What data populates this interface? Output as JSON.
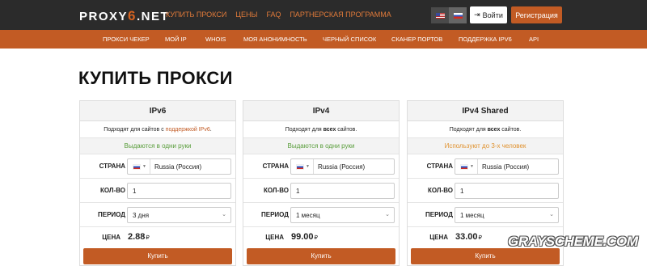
{
  "header": {
    "logo_main": "PROXY",
    "logo_six": "6",
    "logo_tail": ".NET",
    "nav": [
      {
        "label": "КУПИТЬ ПРОКСИ"
      },
      {
        "label": "ЦЕНЫ"
      },
      {
        "label": "FAQ"
      },
      {
        "label": "ПАРТНЕРСКАЯ ПРОГРАММА"
      }
    ],
    "login_label": "Войти",
    "register_label": "Регистрация",
    "colors": {
      "bar": "#2b2b2b",
      "accent": "#c25b24",
      "link": "#e07a3a"
    }
  },
  "subnav": [
    {
      "label": "ПРОКСИ ЧЕКЕР"
    },
    {
      "label": "МОЙ IP"
    },
    {
      "label": "WHOIS"
    },
    {
      "label": "МОЯ АНОНИМНОСТЬ"
    },
    {
      "label": "ЧЕРНЫЙ СПИСОК"
    },
    {
      "label": "СКАНЕР ПОРТОВ"
    },
    {
      "label": "ПОДДЕРЖКА IPV6"
    },
    {
      "label": "API"
    }
  ],
  "page_title": "КУПИТЬ ПРОКСИ",
  "labels": {
    "country": "СТРАНА",
    "quantity": "КОЛ-ВО",
    "period": "ПЕРИОД",
    "price": "ЦЕНА",
    "buy": "Купить",
    "currency": "₽"
  },
  "cards": [
    {
      "title": "IPv6",
      "desc_pre": "Подходят для сайтов с ",
      "desc_hl": "поддержкой IPv6",
      "desc_post": ".",
      "status": "Выдаются в одни руки",
      "status_color": "green",
      "country": "Russia (Россия)",
      "quantity": "1",
      "period": "3 дня",
      "price": "2.88"
    },
    {
      "title": "IPv4",
      "desc_pre": "Подходят для ",
      "desc_hl": "всех",
      "desc_post": " сайтов.",
      "status": "Выдаются в одни руки",
      "status_color": "green",
      "country": "Russia (Россия)",
      "quantity": "1",
      "period": "1 месяц",
      "price": "99.00"
    },
    {
      "title": "IPv4 Shared",
      "desc_pre": "Подходят для ",
      "desc_hl": "всех",
      "desc_post": " сайтов.",
      "status": "Используют до 3-х человек",
      "status_color": "orange",
      "country": "Russia (Россия)",
      "quantity": "1",
      "period": "1 месяц",
      "price": "33.00"
    }
  ],
  "watermark": "GRAYSCHEME.COM"
}
